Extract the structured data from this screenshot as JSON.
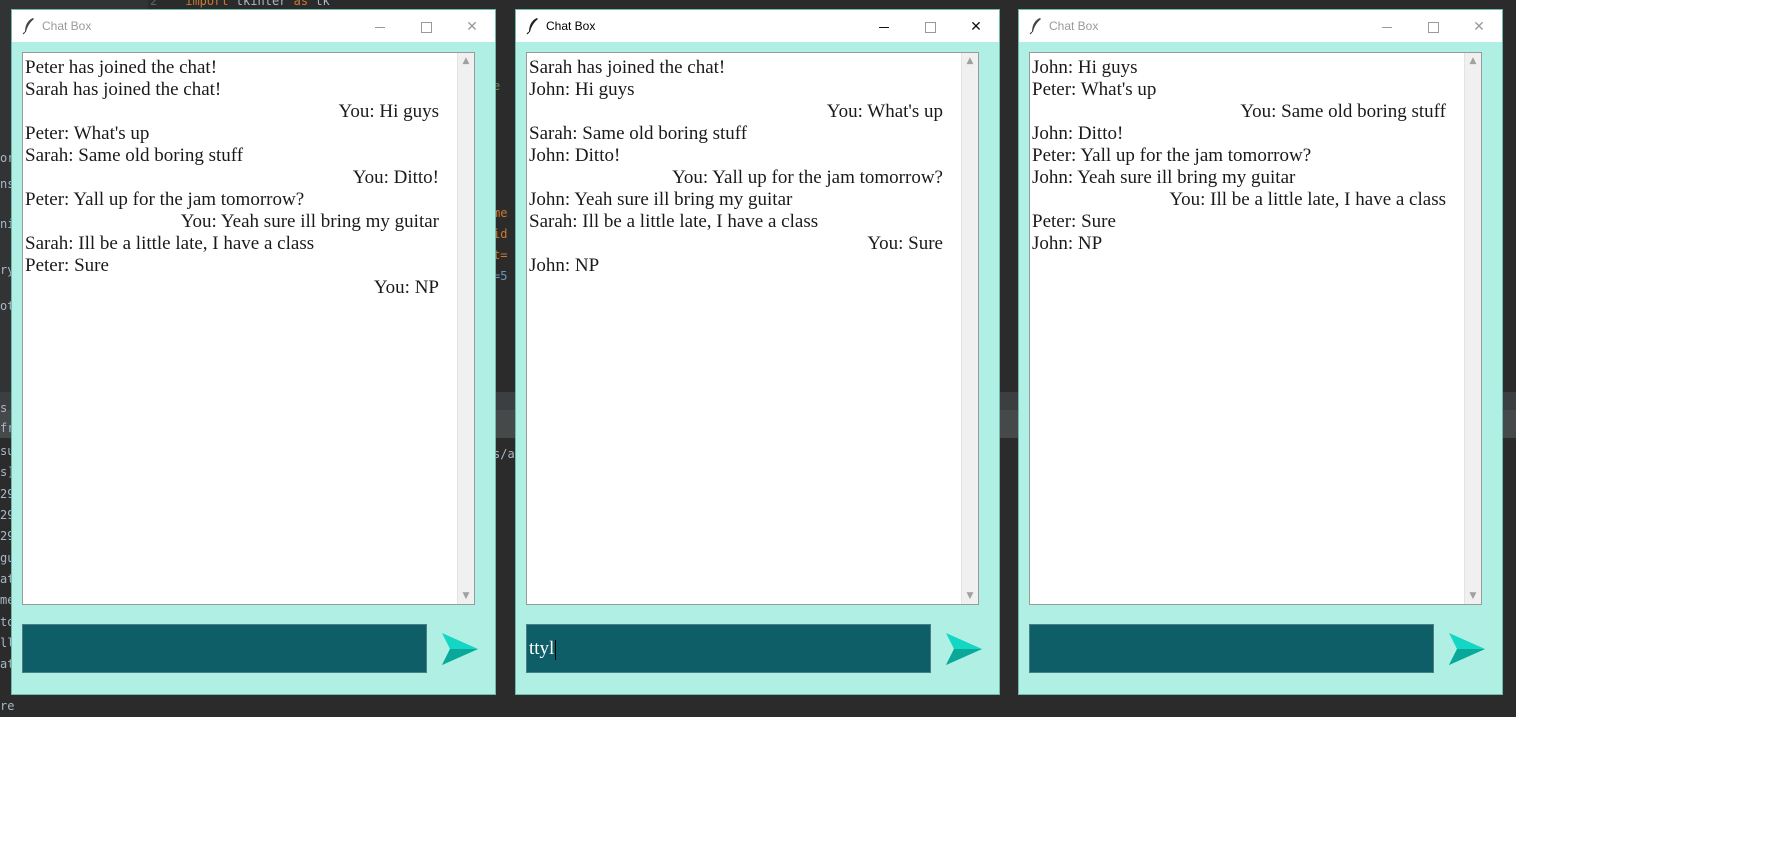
{
  "ide": {
    "code_line_number": "2",
    "code_line": [
      "import",
      "tkinter",
      "as",
      "tk"
    ],
    "left_fragments": [
      "ori",
      "ns",
      "nit",
      "ry",
      "ot",
      "s",
      "fr",
      "su",
      "s]",
      "29",
      "29",
      "29",
      "gu",
      "at",
      "me",
      "to",
      "ll",
      "at",
      "re"
    ],
    "mid_fragments": [
      "e",
      "me",
      "id",
      "t=",
      "=5",
      "s/a"
    ]
  },
  "windows": [
    {
      "title": "Chat Box",
      "active": false,
      "messages": [
        {
          "text": "Peter has joined the chat!",
          "align": "left"
        },
        {
          "text": "Sarah has joined the chat!",
          "align": "left"
        },
        {
          "text": "You: Hi guys",
          "align": "right"
        },
        {
          "text": "Peter: What's up",
          "align": "left"
        },
        {
          "text": "Sarah: Same old boring stuff",
          "align": "left"
        },
        {
          "text": "You: Ditto!",
          "align": "right"
        },
        {
          "text": "Peter: Yall up for the jam tomorrow?",
          "align": "left"
        },
        {
          "text": "You: Yeah sure ill bring my guitar",
          "align": "right"
        },
        {
          "text": "Sarah: Ill be a little late, I have a class",
          "align": "left"
        },
        {
          "text": "Peter: Sure",
          "align": "left"
        },
        {
          "text": "You: NP",
          "align": "right"
        }
      ],
      "input_value": ""
    },
    {
      "title": "Chat Box",
      "active": true,
      "messages": [
        {
          "text": "Sarah has joined the chat!",
          "align": "left"
        },
        {
          "text": "John: Hi guys",
          "align": "left"
        },
        {
          "text": "You: What's up",
          "align": "right"
        },
        {
          "text": "Sarah: Same old boring stuff",
          "align": "left"
        },
        {
          "text": "John: Ditto!",
          "align": "left"
        },
        {
          "text": "You: Yall up for the jam tomorrow?",
          "align": "right"
        },
        {
          "text": "John: Yeah sure ill bring my guitar",
          "align": "left"
        },
        {
          "text": "Sarah: Ill be a little late, I have a class",
          "align": "left"
        },
        {
          "text": "You: Sure",
          "align": "right"
        },
        {
          "text": "John: NP",
          "align": "left"
        }
      ],
      "input_value": "ttyl"
    },
    {
      "title": "Chat Box",
      "active": false,
      "messages": [
        {
          "text": "John: Hi guys",
          "align": "left"
        },
        {
          "text": "Peter: What's up",
          "align": "left"
        },
        {
          "text": "You: Same old boring stuff",
          "align": "right"
        },
        {
          "text": "John: Ditto!",
          "align": "left"
        },
        {
          "text": "Peter: Yall up for the jam tomorrow?",
          "align": "left"
        },
        {
          "text": "John: Yeah sure ill bring my guitar",
          "align": "left"
        },
        {
          "text": "You: Ill be a little late, I have a class",
          "align": "right"
        },
        {
          "text": "Peter: Sure",
          "align": "left"
        },
        {
          "text": "John: NP",
          "align": "left"
        }
      ],
      "input_value": ""
    }
  ],
  "icons": {
    "window_icon": "feather-icon",
    "send": "send-icon",
    "minimize": "minimize-icon",
    "maximize": "maximize-icon",
    "close": "close-icon"
  },
  "colors": {
    "window_bg": "#b0efe3",
    "input_bg": "#0e5e68",
    "send_icon": "#13d6c4"
  }
}
